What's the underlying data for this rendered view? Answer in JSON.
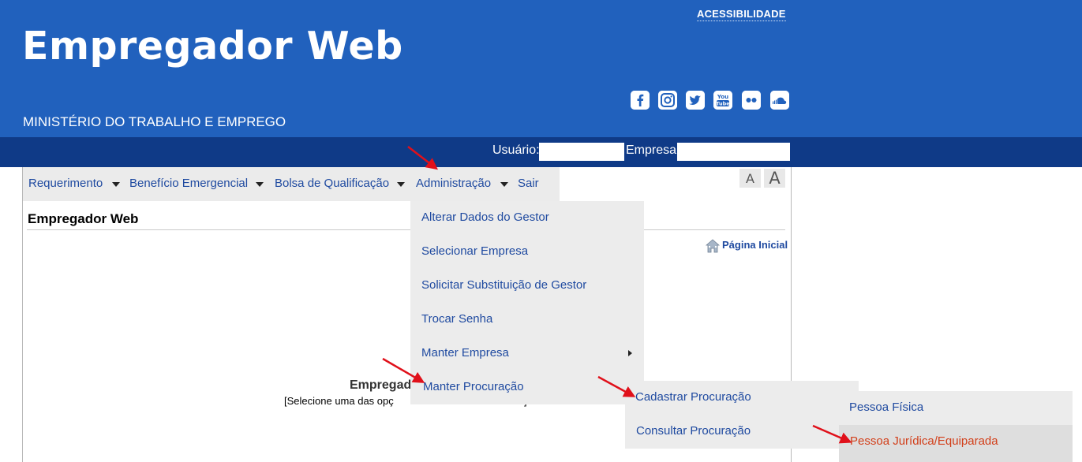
{
  "header": {
    "accessibility": "ACESSIBILIDADE",
    "brand": "Empregador Web",
    "ministry": "MINISTÉRIO DO TRABALHO E EMPREGO",
    "social": [
      {
        "icon": "facebook-icon",
        "glyph": "f"
      },
      {
        "icon": "instagram-icon",
        "glyph": "◎"
      },
      {
        "icon": "twitter-icon",
        "glyph": "t"
      },
      {
        "icon": "youtube-icon",
        "glyph": "You\nTube"
      },
      {
        "icon": "flickr-icon",
        "glyph": "●●"
      },
      {
        "icon": "soundcloud-icon",
        "glyph": "☁"
      }
    ]
  },
  "userbar": {
    "user_label": "Usuário:",
    "user_value": "",
    "company_label": "Empresa:",
    "company_value": ""
  },
  "menu": {
    "items": [
      "Requerimento",
      "Benefício Emergencial",
      "Bolsa de Qualificação",
      "Administração",
      "Sair"
    ]
  },
  "font_controls": {
    "decrease": "A",
    "increase": "A"
  },
  "page": {
    "title": "Empregador Web",
    "home_link": "Página Inicial",
    "center_title_visible": "Empregad",
    "center_sub_left": "[Selecione uma das opç",
    "center_sub_right": "]"
  },
  "admin_menu": {
    "items": [
      "Alterar Dados do Gestor",
      "Selecionar Empresa",
      "Solicitar Substituição de Gestor",
      "Trocar Senha",
      "Manter Empresa",
      "Manter Procuração"
    ]
  },
  "procuracao_menu": {
    "items": [
      "Cadastrar Procuração",
      "Consultar Procuração"
    ]
  },
  "cadastrar_menu": {
    "items": [
      "Pessoa Física",
      "Pessoa Jurídica/Equiparada"
    ]
  },
  "colors": {
    "header_blue": "#2161bd",
    "userbar_navy": "#0f3a87",
    "link_blue": "#1f4aa0",
    "active_red": "#d23f1a",
    "arrow_red": "#e0101a"
  }
}
